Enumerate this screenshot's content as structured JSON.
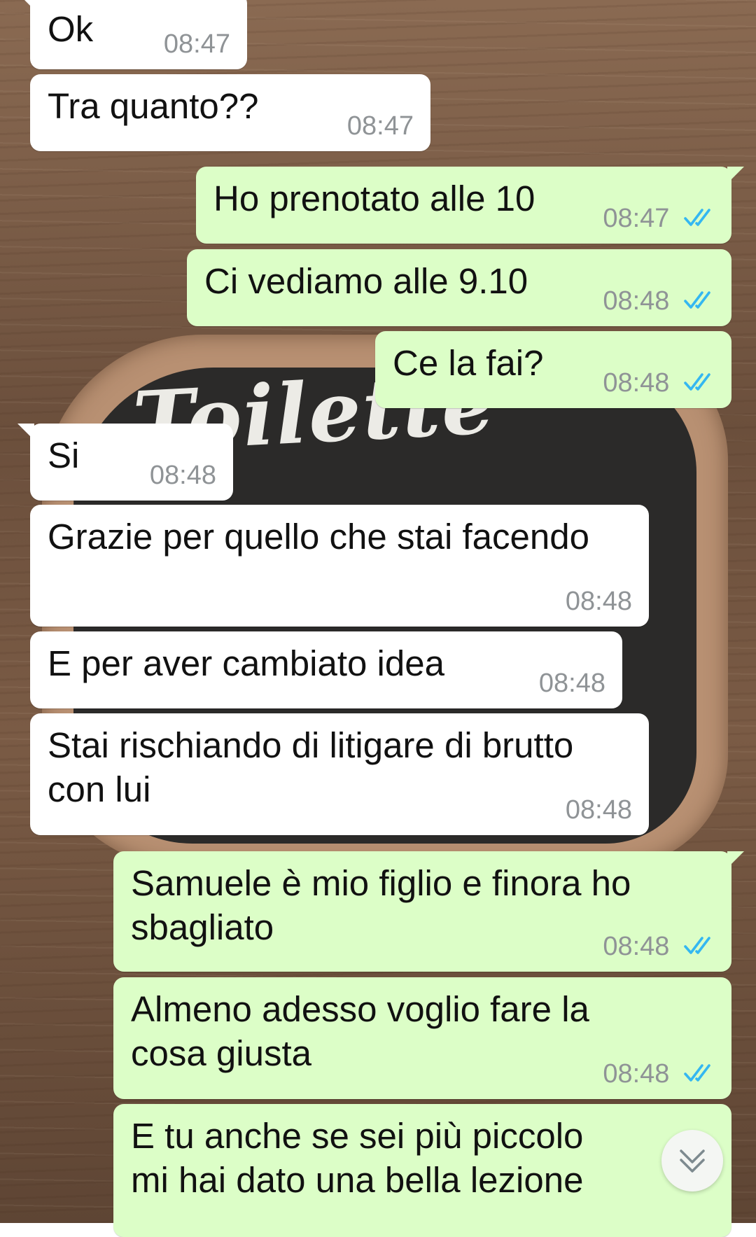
{
  "background": {
    "board_text": "Toilette"
  },
  "messages": [
    {
      "direction": "in",
      "text": "Ok",
      "time": "08:47"
    },
    {
      "direction": "in",
      "text": "Tra quanto??",
      "time": "08:47"
    },
    {
      "direction": "out",
      "text": "Ho prenotato alle 10",
      "time": "08:47",
      "status": "read",
      "status_icon": "double-check-icon"
    },
    {
      "direction": "out",
      "text": "Ci vediamo alle 9.10",
      "time": "08:48",
      "status": "read",
      "status_icon": "double-check-icon"
    },
    {
      "direction": "out",
      "text": "Ce la fai?",
      "time": "08:48",
      "status": "read",
      "status_icon": "double-check-icon"
    },
    {
      "direction": "in",
      "text": "Si",
      "time": "08:48"
    },
    {
      "direction": "in",
      "text": "Grazie per quello che stai facendo",
      "time": "08:48"
    },
    {
      "direction": "in",
      "text": "E per aver cambiato idea",
      "time": "08:48"
    },
    {
      "direction": "in",
      "text": "Stai rischiando di litigare di brutto\ncon lui",
      "time": "08:48"
    },
    {
      "direction": "out",
      "text": "Samuele è mio figlio e finora ho\nsbagliato",
      "time": "08:48",
      "status": "read",
      "status_icon": "double-check-icon"
    },
    {
      "direction": "out",
      "text": "Almeno adesso voglio fare la\ncosa giusta",
      "time": "08:48",
      "status": "read",
      "status_icon": "double-check-icon"
    },
    {
      "direction": "out",
      "text": "E tu anche se sei più piccolo\nmi hai dato una bella lezione",
      "time": ""
    }
  ],
  "scroll_button": {
    "icon": "double-chevron-down-icon"
  },
  "colors": {
    "incoming_bubble": "#ffffff",
    "outgoing_bubble": "#dcfec7",
    "timestamp": "#8f9396",
    "read_ticks": "#34b7f1"
  }
}
